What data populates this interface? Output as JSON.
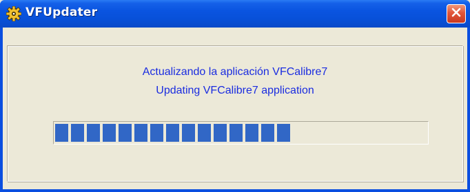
{
  "window": {
    "title": "VFUpdater",
    "icon": "gear-app-icon",
    "close_icon": "close-icon"
  },
  "messages": {
    "line1": "Actualizando la aplicación VFCalibre7",
    "line2": "Updating VFCalibre7 application"
  },
  "progress": {
    "fraction": 0.65,
    "segment_color": "#3167c6"
  },
  "colors": {
    "titlebar": "#0a54e0",
    "message_text": "#1a2ce0",
    "close_button": "#e2553a",
    "window_bg": "#ece9d8"
  }
}
